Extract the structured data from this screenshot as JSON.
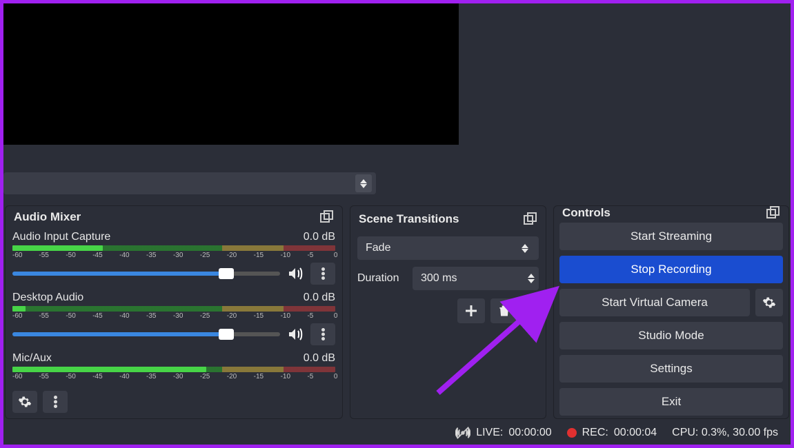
{
  "preview": {
    "blank": true
  },
  "panels": {
    "audio_mixer": {
      "title": "Audio Mixer",
      "channels": [
        {
          "name": "Audio Input Capture",
          "db": "0.0 dB",
          "slider_pct": 80,
          "active_pct": 28,
          "ticks": [
            "-60",
            "-55",
            "-50",
            "-45",
            "-40",
            "-35",
            "-30",
            "-25",
            "-20",
            "-15",
            "-10",
            "-5",
            "0"
          ]
        },
        {
          "name": "Desktop Audio",
          "db": "0.0 dB",
          "slider_pct": 80,
          "active_pct": 4,
          "ticks": [
            "-60",
            "-55",
            "-50",
            "-45",
            "-40",
            "-35",
            "-30",
            "-25",
            "-20",
            "-15",
            "-10",
            "-5",
            "0"
          ]
        },
        {
          "name": "Mic/Aux",
          "db": "0.0 dB",
          "slider_pct": 80,
          "active_pct": 60,
          "ticks": [
            "-60",
            "-55",
            "-50",
            "-45",
            "-40",
            "-35",
            "-30",
            "-25",
            "-20",
            "-15",
            "-10",
            "-5",
            "0"
          ]
        }
      ]
    },
    "scene_transitions": {
      "title": "Scene Transitions",
      "selected": "Fade",
      "duration_label": "Duration",
      "duration_value": "300 ms"
    },
    "controls": {
      "title": "Controls",
      "buttons": {
        "start_streaming": "Start Streaming",
        "stop_recording": "Stop Recording",
        "start_virtual_camera": "Start Virtual Camera",
        "studio_mode": "Studio Mode",
        "settings": "Settings",
        "exit": "Exit"
      }
    }
  },
  "status": {
    "live_label": "LIVE:",
    "live_time": "00:00:00",
    "rec_label": "REC:",
    "rec_time": "00:00:04",
    "cpu": "CPU: 0.3%, 30.00 fps"
  }
}
